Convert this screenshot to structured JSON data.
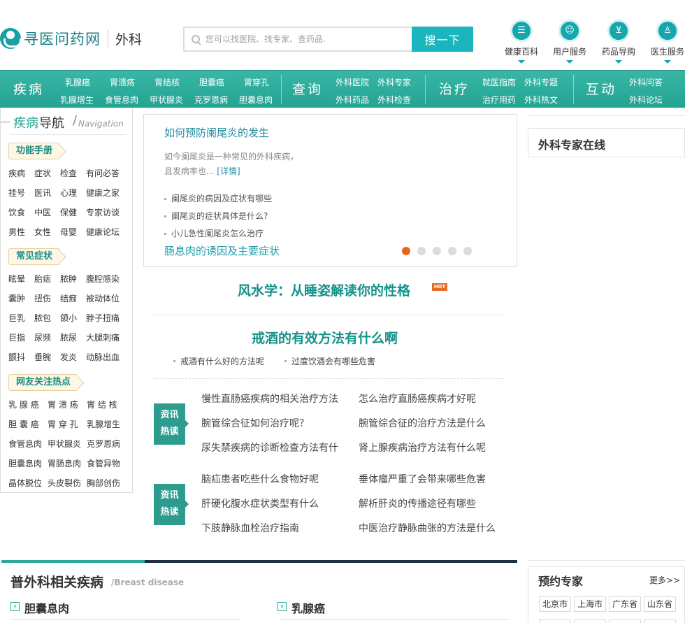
{
  "header": {
    "logo_text": "寻医问药网",
    "section": "外科",
    "search_placeholder": "您可以找医院、找专家、查药品.",
    "search_button": "搜一下",
    "top_nav": [
      {
        "label": "健康百科",
        "icon": "list-icon"
      },
      {
        "label": "用户服务",
        "icon": "user-icon"
      },
      {
        "label": "药品导购",
        "icon": "cart-icon"
      },
      {
        "label": "医生服务",
        "icon": "doctor-icon"
      }
    ]
  },
  "main_nav": {
    "sections": [
      {
        "title": "疾病",
        "links": [
          "乳腺癌",
          "胃溃疡",
          "胃结核",
          "胆囊癌",
          "胃穿孔",
          "乳腺增生",
          "食管息肉",
          "甲状腺炎",
          "克罗恩病",
          "胆囊息肉"
        ]
      },
      {
        "title": "查询",
        "links": [
          "外科医院",
          "外科专家",
          "外科药品",
          "外科检查"
        ]
      },
      {
        "title": "治疗",
        "links": [
          "就医指南",
          "外科专题",
          "治疗用药",
          "外科热文"
        ]
      },
      {
        "title": "互动",
        "links": [
          "外科问答",
          "外科论坛"
        ]
      }
    ]
  },
  "sidebar": {
    "title_main": "疾病",
    "title_main2": "导航",
    "title_slash": "/",
    "title_en": "Navigation",
    "groups": [
      {
        "tag": "功能手册",
        "rows": [
          [
            "疾病",
            "症状",
            "检查",
            "有问必答"
          ],
          [
            "挂号",
            "医讯",
            "心理",
            "健康之家"
          ],
          [
            "饮食",
            "中医",
            "保健",
            "专家访谈"
          ],
          [
            "男性",
            "女性",
            "母婴",
            "健康论坛"
          ]
        ]
      },
      {
        "tag": "常见症状",
        "rows": [
          [
            "眩晕",
            "胎痣",
            "脓肿",
            "腹腔感染"
          ],
          [
            "囊肿",
            "扭伤",
            "结痂",
            "被动体位"
          ],
          [
            "巨乳",
            "脓包",
            "颌小",
            "脖子扭痛"
          ],
          [
            "巨指",
            "尿频",
            "脓尿",
            "大腿刺痛"
          ],
          [
            "颤抖",
            "垂腕",
            "发炎",
            "动脉出血"
          ]
        ]
      },
      {
        "tag": "网友关注热点",
        "rows": [
          [
            "乳 腺 癌",
            "胃 溃 疡",
            "胃 结 核"
          ],
          [
            "胆 囊 癌",
            "胃 穿 孔",
            "乳腺增生"
          ],
          [
            "食管息肉",
            "甲状腺炎",
            "克罗恩病"
          ],
          [
            "胆囊息肉",
            "胃肠息肉",
            "食管异物"
          ],
          [
            "晶体脱位",
            "头皮裂伤",
            "胸部创伤"
          ]
        ]
      }
    ]
  },
  "slider": {
    "title": "如何预防阑尾炎的发生",
    "desc_line1": "如今阑尾炎是一种常见的外科疾病，",
    "desc_line2": "且发病率也...",
    "more": "[详情]",
    "items": [
      "阑尾炎的病因及症状有哪些",
      "阑尾炎的症状具体是什么?",
      "小儿急性阑尾炎怎么治疗"
    ],
    "bottom_title": "肠息肉的诱因及主要症状",
    "dot_count": 5,
    "active_dot": 0
  },
  "headlines": {
    "h1": "风水学：从睡姿解读你的性格",
    "hot": "HOT",
    "h2": "戒酒的有效方法有什么啊",
    "sub_links": [
      "戒酒有什么好的方法呢",
      "过度饮酒会有哪些危害"
    ]
  },
  "news": {
    "badge_line1": "资讯",
    "badge_line2": "热读",
    "group1": [
      [
        "慢性直肠癌疾病的相关治疗方法",
        "怎么治疗直肠癌疾病才好呢"
      ],
      [
        "腕管综合征如何治疗呢？",
        "腕管综合征的治疗方法是什么"
      ],
      [
        "尿失禁疾病的诊断检查方法有什",
        "肾上腺疾病治疗方法有什么呢"
      ]
    ],
    "group2": [
      [
        "脑疝患者吃些什么食物好呢",
        "垂体瘤严重了会带来哪些危害"
      ],
      [
        "肝硬化腹水症状类型有什么",
        "解析肝炎的传播途径有哪些"
      ],
      [
        "下肢静脉血栓治疗指南",
        "中医治疗静脉曲张的方法是什么"
      ]
    ]
  },
  "bottom": {
    "title": "普外科相关疾病",
    "title_en": "/Breast disease",
    "diseases": [
      "胆囊息肉",
      "乳腺癌"
    ]
  },
  "right": {
    "expert_title": "外科专家在线",
    "appoint_title": "预约专家",
    "appoint_more": "更多>>",
    "provinces": [
      "北京市",
      "上海市",
      "广东省",
      "山东省"
    ]
  },
  "colors": {
    "accent": "#2aa597",
    "nav_green": "#23a392",
    "search_btn": "#1ab5bd",
    "active_dot": "#e8641d"
  }
}
